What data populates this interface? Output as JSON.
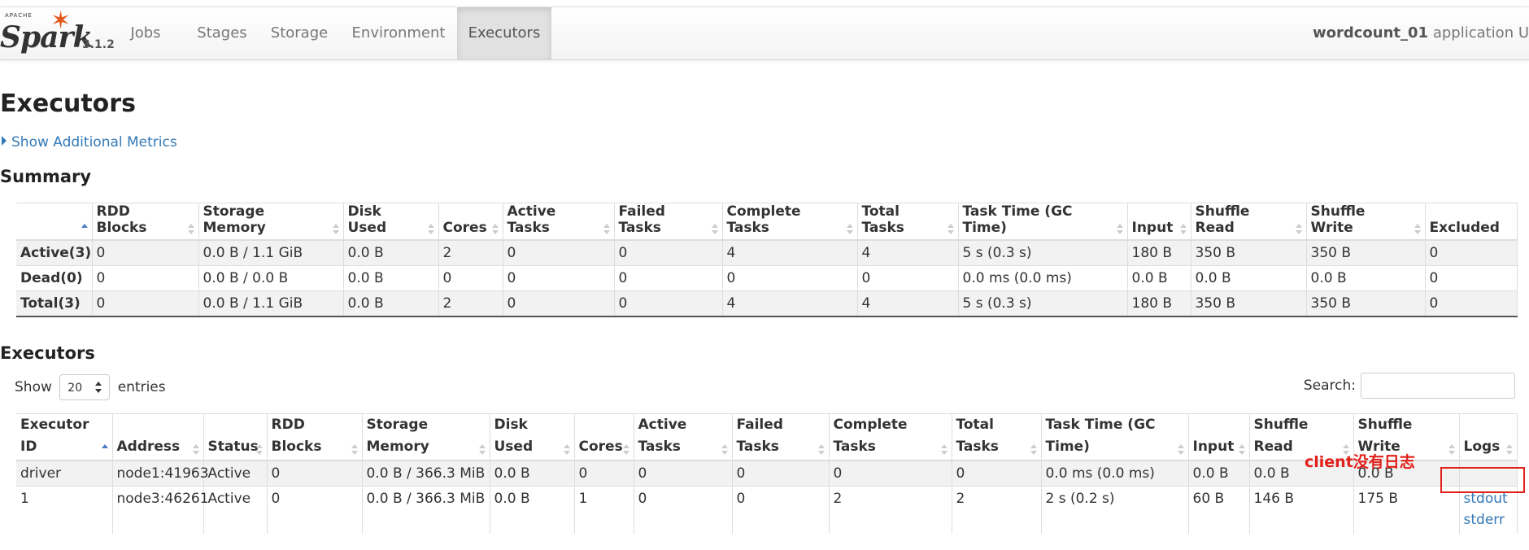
{
  "brand": {
    "apache": "APACHE",
    "word": "Spark",
    "version": "3.1.2"
  },
  "nav": {
    "tabs": [
      "Jobs",
      "Stages",
      "Storage",
      "Environment",
      "Executors"
    ],
    "active": "Executors"
  },
  "app": {
    "name": "wordcount_01",
    "suffix": "application U"
  },
  "page_title": "Executors",
  "metrics_link": "Show Additional Metrics",
  "summary": {
    "title": "Summary",
    "headers": [
      "",
      "RDD Blocks",
      "Storage Memory",
      "Disk Used",
      "Cores",
      "Active Tasks",
      "Failed Tasks",
      "Complete Tasks",
      "Total Tasks",
      "Task Time (GC Time)",
      "Input",
      "Shuffle Read",
      "Shuffle Write",
      "Excluded"
    ],
    "rows": [
      [
        "Active(3)",
        "0",
        "0.0 B / 1.1 GiB",
        "0.0 B",
        "2",
        "0",
        "0",
        "4",
        "4",
        "5 s (0.3 s)",
        "180 B",
        "350 B",
        "350 B",
        "0"
      ],
      [
        "Dead(0)",
        "0",
        "0.0 B / 0.0 B",
        "0.0 B",
        "0",
        "0",
        "0",
        "0",
        "0",
        "0.0 ms (0.0 ms)",
        "0.0 B",
        "0.0 B",
        "0.0 B",
        "0"
      ],
      [
        "Total(3)",
        "0",
        "0.0 B / 1.1 GiB",
        "0.0 B",
        "2",
        "0",
        "0",
        "4",
        "4",
        "5 s (0.3 s)",
        "180 B",
        "350 B",
        "350 B",
        "0"
      ]
    ]
  },
  "executors": {
    "title": "Executors",
    "show_label": "Show",
    "entries_value": "20",
    "entries_label": "entries",
    "search_label": "Search:",
    "search_value": "",
    "headers": [
      "Executor ID",
      "Address",
      "Status",
      "RDD Blocks",
      "Storage Memory",
      "Disk Used",
      "Cores",
      "Active Tasks",
      "Failed Tasks",
      "Complete Tasks",
      "Total Tasks",
      "Task Time (GC Time)",
      "Input",
      "Shuffle Read",
      "Shuffle Write",
      "Logs"
    ],
    "rows": [
      {
        "cells": [
          "driver",
          "node1:41963",
          "Active",
          "0",
          "0.0 B / 366.3 MiB",
          "0.0 B",
          "0",
          "0",
          "0",
          "0",
          "0",
          "0.0 ms (0.0 ms)",
          "0.0 B",
          "0.0 B",
          "0.0 B"
        ],
        "logs": []
      },
      {
        "cells": [
          "1",
          "node3:46261",
          "Active",
          "0",
          "0.0 B / 366.3 MiB",
          "0.0 B",
          "1",
          "0",
          "0",
          "2",
          "2",
          "2 s (0.2 s)",
          "60 B",
          "146 B",
          "175 B"
        ],
        "logs": [
          "stdout",
          "stderr"
        ]
      }
    ]
  },
  "annotation": {
    "text": "client没有日志",
    "color": "#e0201a"
  },
  "colors": {
    "link": "#337ab7",
    "accent": "#e25a1c",
    "stripe": "#f2f2f2"
  }
}
